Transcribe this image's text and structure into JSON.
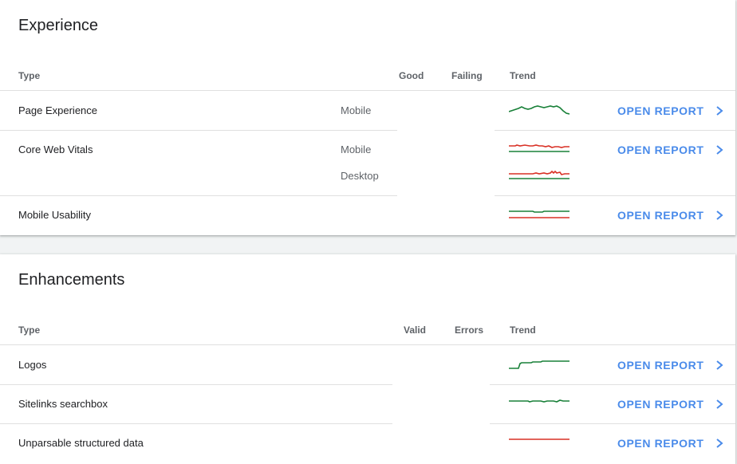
{
  "experience": {
    "title": "Experience",
    "headers": {
      "type": "Type",
      "good": "Good",
      "failing": "Failing",
      "trend": "Trend"
    },
    "rows": [
      {
        "label": "Page Experience",
        "devices": [
          "Mobile"
        ],
        "action": "OPEN REPORT"
      },
      {
        "label": "Core Web Vitals",
        "devices": [
          "Mobile",
          "Desktop"
        ],
        "action": "OPEN REPORT"
      },
      {
        "label": "Mobile Usability",
        "devices": [],
        "action": "OPEN REPORT"
      }
    ]
  },
  "enhancements": {
    "title": "Enhancements",
    "headers": {
      "type": "Type",
      "valid": "Valid",
      "errors": "Errors",
      "trend": "Trend"
    },
    "rows": [
      {
        "label": "Logos",
        "action": "OPEN REPORT"
      },
      {
        "label": "Sitelinks searchbox",
        "action": "OPEN REPORT"
      },
      {
        "label": "Unparsable structured data",
        "action": "OPEN REPORT"
      }
    ]
  },
  "colors": {
    "good": "#188038",
    "bad": "#d93025",
    "link": "#4a8bea"
  },
  "icons": {
    "open_report": "chevron-right-icon"
  }
}
